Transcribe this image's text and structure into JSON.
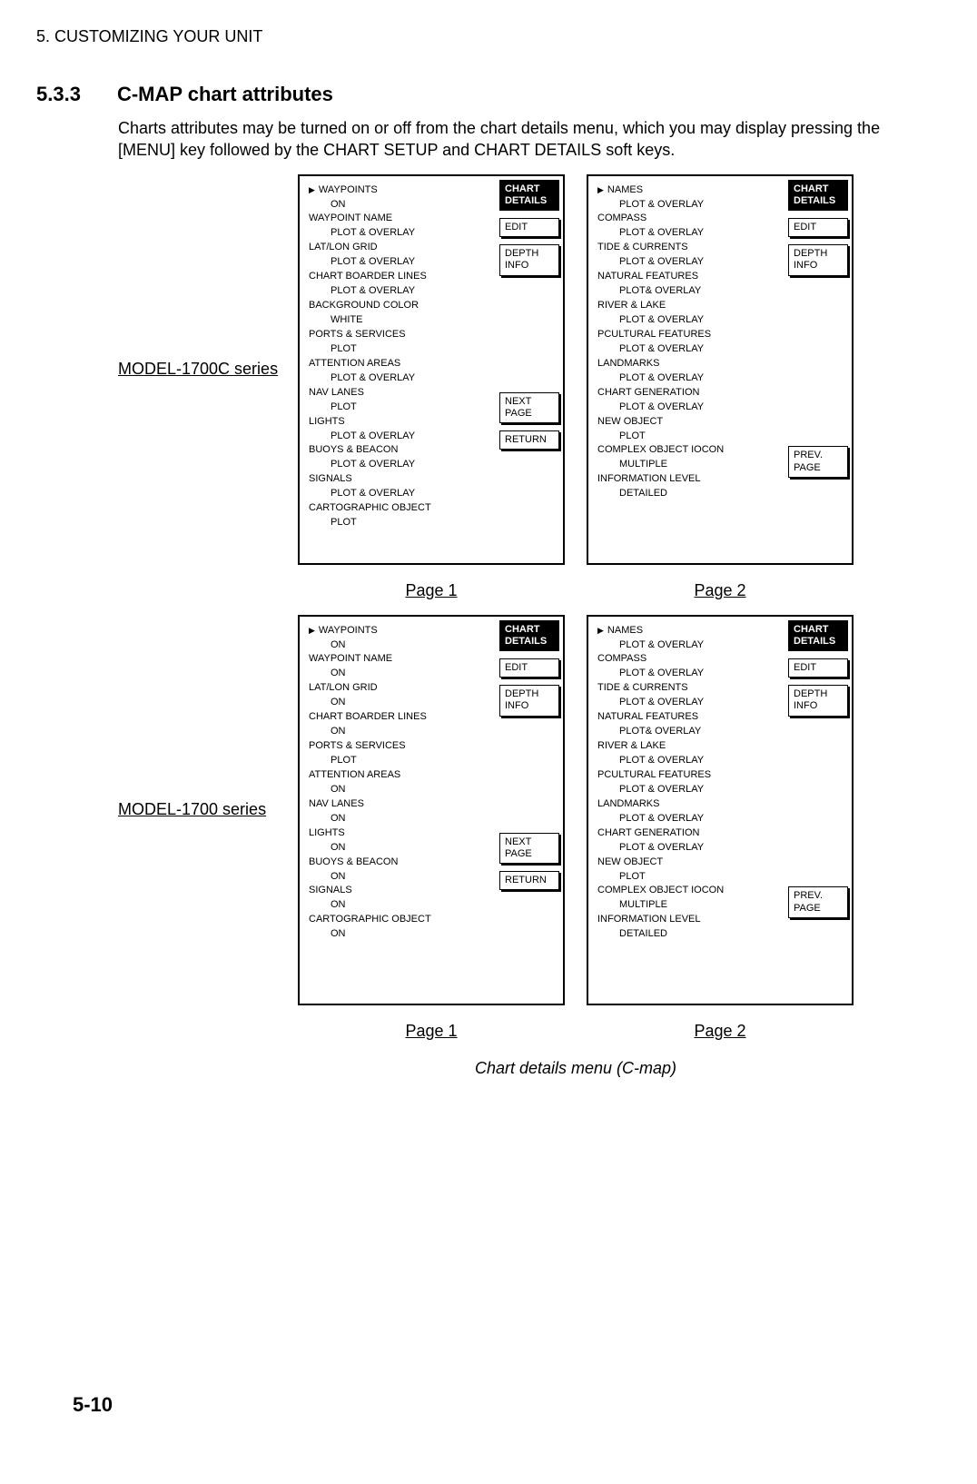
{
  "chapter": "5. CUSTOMIZING YOUR UNIT",
  "section": {
    "number": "5.3.3",
    "title": "C-MAP chart attributes"
  },
  "paragraph": "Charts attributes may be turned on or off from the chart details menu, which you may display pressing the [MENU] key followed by the CHART SETUP and CHART DETAILS soft keys.",
  "models": [
    {
      "label": "MODEL-1700C series",
      "page1_menu": [
        {
          "t": "WAYPOINTS",
          "first": true
        },
        {
          "t": "ON",
          "v": true
        },
        {
          "t": "WAYPOINT NAME"
        },
        {
          "t": "PLOT & OVERLAY",
          "v": true
        },
        {
          "t": "LAT/LON GRID"
        },
        {
          "t": "PLOT & OVERLAY",
          "v": true
        },
        {
          "t": "CHART BOARDER LINES"
        },
        {
          "t": "PLOT & OVERLAY",
          "v": true
        },
        {
          "t": "BACKGROUND COLOR"
        },
        {
          "t": "WHITE",
          "v": true
        },
        {
          "t": "PORTS & SERVICES"
        },
        {
          "t": "PLOT",
          "v": true
        },
        {
          "t": "ATTENTION AREAS"
        },
        {
          "t": "PLOT & OVERLAY",
          "v": true
        },
        {
          "t": "NAV LANES"
        },
        {
          "t": "PLOT",
          "v": true
        },
        {
          "t": "LIGHTS"
        },
        {
          "t": "PLOT & OVERLAY",
          "v": true
        },
        {
          "t": "BUOYS & BEACON"
        },
        {
          "t": "PLOT & OVERLAY",
          "v": true
        },
        {
          "t": "SIGNALS"
        },
        {
          "t": "PLOT & OVERLAY",
          "v": true
        },
        {
          "t": "CARTOGRAPHIC OBJECT"
        },
        {
          "t": "PLOT",
          "v": true
        }
      ]
    },
    {
      "label": "MODEL-1700 series",
      "page1_menu": [
        {
          "t": "WAYPOINTS",
          "first": true
        },
        {
          "t": "ON",
          "v": true
        },
        {
          "t": "WAYPOINT NAME"
        },
        {
          "t": "ON",
          "v": true
        },
        {
          "t": "LAT/LON GRID"
        },
        {
          "t": "ON",
          "v": true
        },
        {
          "t": "CHART BOARDER LINES"
        },
        {
          "t": "ON",
          "v": true
        },
        {
          "t": "PORTS & SERVICES"
        },
        {
          "t": "PLOT",
          "v": true
        },
        {
          "t": "ATTENTION AREAS"
        },
        {
          "t": "ON",
          "v": true
        },
        {
          "t": "NAV LANES"
        },
        {
          "t": "ON",
          "v": true
        },
        {
          "t": "LIGHTS"
        },
        {
          "t": "ON",
          "v": true
        },
        {
          "t": "BUOYS & BEACON"
        },
        {
          "t": "ON",
          "v": true
        },
        {
          "t": "SIGNALS"
        },
        {
          "t": "ON",
          "v": true
        },
        {
          "t": "CARTOGRAPHIC OBJECT"
        },
        {
          "t": "ON",
          "v": true
        }
      ]
    }
  ],
  "page2_menu": [
    {
      "t": "NAMES",
      "first": true
    },
    {
      "t": "PLOT & OVERLAY",
      "v": true
    },
    {
      "t": "COMPASS"
    },
    {
      "t": "PLOT & OVERLAY",
      "v": true
    },
    {
      "t": "TIDE & CURRENTS"
    },
    {
      "t": "PLOT & OVERLAY",
      "v": true
    },
    {
      "t": "NATURAL FEATURES"
    },
    {
      "t": "PLOT& OVERLAY",
      "v": true
    },
    {
      "t": "RIVER & LAKE"
    },
    {
      "t": "PLOT & OVERLAY",
      "v": true
    },
    {
      "t": "PCULTURAL FEATURES"
    },
    {
      "t": "PLOT & OVERLAY",
      "v": true
    },
    {
      "t": "LANDMARKS"
    },
    {
      "t": "PLOT & OVERLAY",
      "v": true
    },
    {
      "t": "CHART GENERATION"
    },
    {
      "t": "PLOT & OVERLAY",
      "v": true
    },
    {
      "t": "NEW OBJECT"
    },
    {
      "t": "PLOT",
      "v": true
    },
    {
      "t": "COMPLEX OBJECT IOCON"
    },
    {
      "t": "MULTIPLE",
      "v": true
    },
    {
      "t": "INFORMATION LEVEL"
    },
    {
      "t": "DETAILED",
      "v": true
    }
  ],
  "softkeys": {
    "header": "CHART\nDETAILS",
    "edit": "EDIT",
    "depth": "DEPTH\nINFO",
    "next": "NEXT\nPAGE",
    "prev": "PREV.\nPAGE",
    "return": "RETURN"
  },
  "page_labels": {
    "p1": "Page 1",
    "p2": "Page 2"
  },
  "caption": "Chart details menu (C-map)",
  "page_number": "5-10"
}
